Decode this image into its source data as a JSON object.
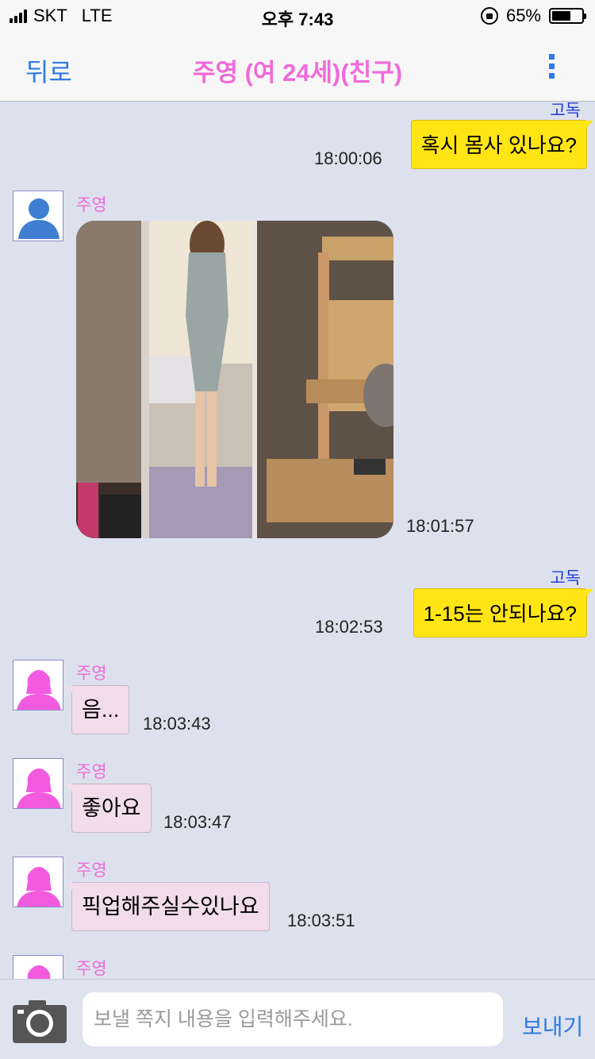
{
  "status": {
    "carrier": "SKT",
    "network": "LTE",
    "time": "오후 7:43",
    "battery_text": "65%",
    "battery_level": 0.65
  },
  "nav": {
    "back_label": "뒤로",
    "title": "주영 (여 24세)(친구)",
    "menu_icon": "kebab-menu-icon"
  },
  "colors": {
    "accent_blue": "#2f7ae5",
    "pink_name": "#f06ad8",
    "outgoing_bubble": "#ffe514",
    "incoming_bubble": "#f2dcea",
    "background": "#dde1ee"
  },
  "messages": [
    {
      "direction": "out",
      "sender": "고독",
      "text": "혹시 몸사 있나요?",
      "time": "18:00:06"
    },
    {
      "direction": "in",
      "sender": "주영",
      "type": "image",
      "avatar": "default-person-icon",
      "time": "18:01:57"
    },
    {
      "direction": "out",
      "sender": "고독",
      "text": "1-15는 안되나요?",
      "time": "18:02:53"
    },
    {
      "direction": "in",
      "sender": "주영",
      "text": "음...",
      "avatar": "female-person-icon",
      "time": "18:03:43"
    },
    {
      "direction": "in",
      "sender": "주영",
      "text": "좋아요",
      "avatar": "female-person-icon",
      "time": "18:03:47"
    },
    {
      "direction": "in",
      "sender": "주영",
      "text": "픽업해주실수있나요",
      "avatar": "female-person-icon",
      "time": "18:03:51"
    },
    {
      "direction": "in",
      "sender": "주영",
      "avatar": "female-person-icon"
    }
  ],
  "composer": {
    "camera_icon": "camera-icon",
    "placeholder": "보낼 쪽지 내용을 입력해주세요.",
    "value": "",
    "send_label": "보내기"
  }
}
